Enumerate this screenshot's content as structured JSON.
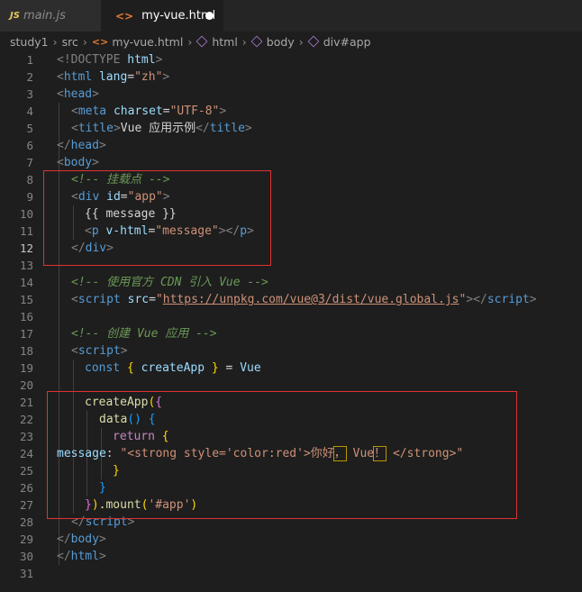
{
  "tabs": [
    {
      "badge": "JS",
      "label": "main.js"
    },
    {
      "badge": "<>",
      "label": "my-vue.html"
    }
  ],
  "breadcrumb": [
    "study1",
    "src",
    "my-vue.html",
    "html",
    "body",
    "div#app"
  ],
  "active_line": 12,
  "lines": {
    "l1": [
      "<!DOCTYPE",
      " ",
      "html",
      ">"
    ],
    "l2": [
      "<",
      "html",
      " ",
      "lang",
      "=",
      "\"zh\"",
      ">"
    ],
    "l3": [
      "<",
      "head",
      ">"
    ],
    "l4": [
      "<",
      "meta",
      " ",
      "charset",
      "=",
      "\"UTF-8\"",
      ">"
    ],
    "l5": [
      "<",
      "title",
      ">",
      "Vue 应用示例",
      "</",
      "title",
      ">"
    ],
    "l6": [
      "</",
      "head",
      ">"
    ],
    "l7": [
      "<",
      "body",
      ">"
    ],
    "l8": "<!-- 挂载点 -->",
    "l9": [
      "<",
      "div",
      " ",
      "id",
      "=",
      "\"app\"",
      ">"
    ],
    "l10": "{{ message }}",
    "l11": [
      "<",
      "p",
      " ",
      "v-html",
      "=",
      "\"message\"",
      "></",
      "p",
      ">"
    ],
    "l12": [
      "</",
      "div",
      ">"
    ],
    "l14": "<!-- 使用官方 CDN 引入 Vue -->",
    "l15": [
      "<",
      "script",
      " ",
      "src",
      "=",
      "\"",
      "https://unpkg.com/vue@3/dist/vue.global.js",
      "\"",
      "></",
      "script",
      ">"
    ],
    "l17": "<!-- 创建 Vue 应用 -->",
    "l18": [
      "<",
      "script",
      ">"
    ],
    "l19": [
      "const",
      " ",
      "{",
      " ",
      "createApp",
      " ",
      "}",
      " = ",
      "Vue"
    ],
    "l21": [
      "createApp",
      "(",
      "{"
    ],
    "l22": [
      "data",
      "()",
      " ",
      "{"
    ],
    "l23": [
      "return",
      " ",
      "{"
    ],
    "l24": [
      "message",
      ": ",
      "\"<strong style='color:red'>你好",
      "，",
      " Vue",
      "！",
      " </strong>\""
    ],
    "l25": "}",
    "l26": "}",
    "l27": [
      "}",
      ")",
      ".mount",
      "(",
      "'#app'",
      ")"
    ],
    "l28": [
      "</",
      "script",
      ">"
    ],
    "l29": [
      "</",
      "body",
      ">"
    ],
    "l30": [
      "</",
      "html",
      ">"
    ]
  },
  "line_numbers": [
    "1",
    "2",
    "3",
    "4",
    "5",
    "6",
    "7",
    "8",
    "9",
    "10",
    "11",
    "12",
    "13",
    "14",
    "15",
    "16",
    "17",
    "18",
    "19",
    "20",
    "21",
    "22",
    "23",
    "24",
    "25",
    "26",
    "27",
    "28",
    "29",
    "30",
    "31"
  ],
  "colors": {
    "annotation_box": "#e03232",
    "background": "#1e1e1e",
    "tag": "#569cd6",
    "attr": "#9cdcfe",
    "string": "#ce9178",
    "comment": "#6a9955"
  }
}
